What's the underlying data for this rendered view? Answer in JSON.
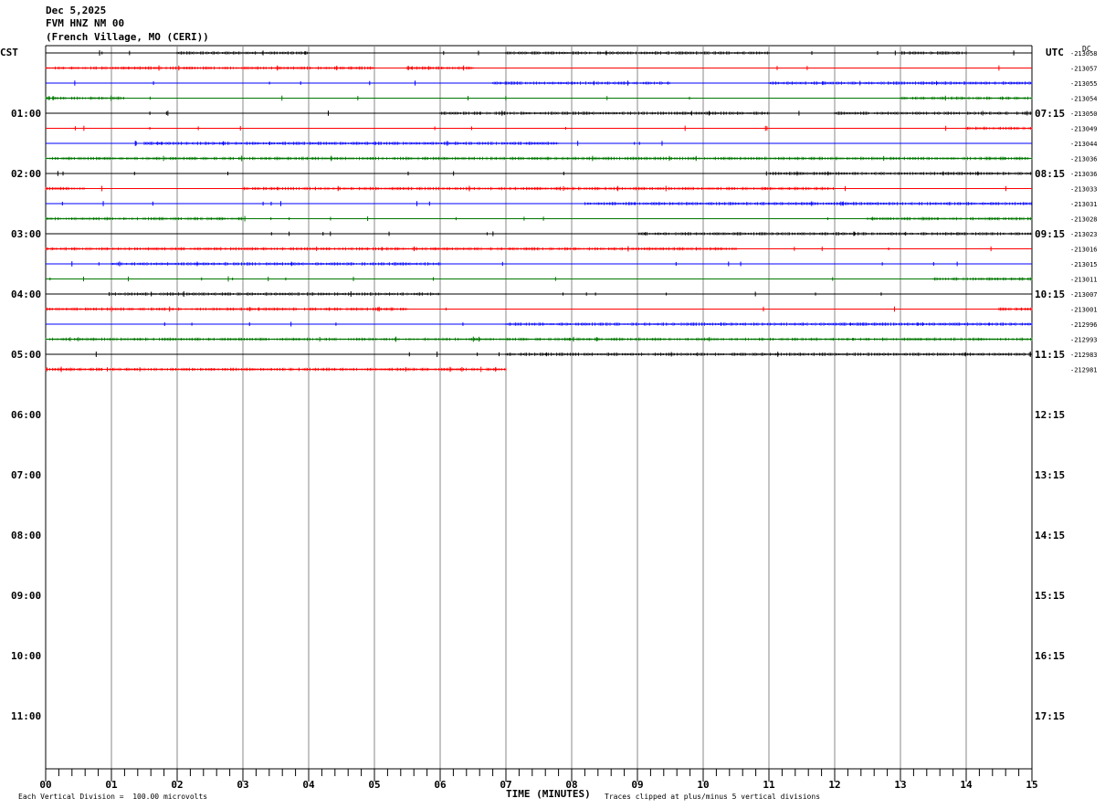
{
  "header": {
    "date": "Dec 5,2025",
    "station": "FVM HNZ NM 00",
    "location": "(French Village, MO (CERI))"
  },
  "left_tz": "CST",
  "right_tz": "UTC",
  "dc_label": "DC",
  "x_axis_title": "TIME (MINUTES)",
  "footer": {
    "scale_note": "Each Vertical Division =  100.00 microvolts",
    "clip_note": "Traces clipped at plus/minus 5 vertical divisions"
  },
  "chart_data": {
    "type": "line",
    "title": "FVM HNZ NM 00",
    "xlabel": "TIME (MINUTES)",
    "xlim": [
      0,
      15
    ],
    "x_ticks": [
      "00",
      "01",
      "02",
      "03",
      "04",
      "05",
      "06",
      "07",
      "08",
      "09",
      "10",
      "11",
      "12",
      "13",
      "14",
      "15"
    ],
    "x_minor_step": 0.2,
    "grid": true,
    "minutes_per_line": 15,
    "line_count": 48,
    "colors": [
      "#000000",
      "#ff0000",
      "#0000ff",
      "#007700"
    ],
    "left_hour_labels": [
      "01:00",
      "02:00",
      "03:00",
      "04:00",
      "05:00",
      "06:00",
      "07:00",
      "08:00",
      "09:00",
      "10:00",
      "11:00"
    ],
    "right_hour_labels": [
      "07:15",
      "08:15",
      "09:15",
      "10:15",
      "11:15",
      "12:15",
      "13:15",
      "14:15",
      "15:15",
      "16:15",
      "17:15"
    ],
    "dc_offsets": [
      "-213058",
      "-213057",
      "-213055",
      "-213054",
      "-213050",
      "-213049",
      "-213044",
      "-213036",
      "-213036",
      "-213033",
      "-213031",
      "-213028",
      "-213023",
      "-213016",
      "-213015",
      "-213011",
      "-213007",
      "-213001",
      "-212996",
      "-212993",
      "-212983",
      "-212981"
    ],
    "traces": [
      {
        "line": 0,
        "start": 0,
        "end": 15,
        "quiet": [
          [
            0,
            4
          ],
          [
            5,
            10.5
          ],
          [
            12,
            14
          ]
        ],
        "noisy": [
          [
            2,
            4
          ],
          [
            7,
            11
          ],
          [
            13,
            14
          ]
        ]
      },
      {
        "line": 1,
        "start": 0,
        "end": 15,
        "noisy": [
          [
            0,
            5
          ],
          [
            5.5,
            6.5
          ]
        ]
      },
      {
        "line": 2,
        "start": 0,
        "end": 15,
        "noisy": [
          [
            6.8,
            9.5
          ],
          [
            11,
            15
          ]
        ]
      },
      {
        "line": 3,
        "start": 0,
        "end": 15,
        "noisy": [
          [
            0,
            1.2
          ],
          [
            13,
            15
          ]
        ]
      },
      {
        "line": 4,
        "start": 0,
        "end": 15,
        "noisy": [
          [
            6,
            11
          ],
          [
            12,
            15
          ]
        ]
      },
      {
        "line": 5,
        "start": 0,
        "end": 15,
        "noisy": [
          [
            14,
            15
          ]
        ]
      },
      {
        "line": 6,
        "start": 0,
        "end": 15,
        "noisy": [
          [
            1.5,
            7.8
          ]
        ]
      },
      {
        "line": 7,
        "start": 0,
        "end": 15,
        "noisy": [
          [
            0,
            15
          ]
        ]
      },
      {
        "line": 8,
        "start": 0,
        "end": 15,
        "noisy": [
          [
            11,
            15
          ]
        ]
      },
      {
        "line": 9,
        "start": 0,
        "end": 15,
        "noisy": [
          [
            0,
            0.6
          ],
          [
            3,
            12
          ]
        ]
      },
      {
        "line": 10,
        "start": 0,
        "end": 15,
        "noisy": [
          [
            8.2,
            15
          ]
        ]
      },
      {
        "line": 11,
        "start": 0,
        "end": 15,
        "noisy": [
          [
            0,
            3
          ],
          [
            12.5,
            15
          ]
        ]
      },
      {
        "line": 12,
        "start": 0,
        "end": 15,
        "noisy": [
          [
            9,
            15
          ]
        ]
      },
      {
        "line": 13,
        "start": 0,
        "end": 15,
        "noisy": [
          [
            0,
            10.5
          ]
        ]
      },
      {
        "line": 14,
        "start": 0,
        "end": 15,
        "noisy": [
          [
            1,
            6
          ]
        ]
      },
      {
        "line": 15,
        "start": 0,
        "end": 15,
        "noisy": [
          [
            13.5,
            15
          ]
        ]
      },
      {
        "line": 16,
        "start": 0,
        "end": 15,
        "noisy": [
          [
            1,
            6
          ]
        ]
      },
      {
        "line": 17,
        "start": 0,
        "end": 15,
        "noisy": [
          [
            0,
            5.5
          ],
          [
            14.5,
            15
          ]
        ]
      },
      {
        "line": 18,
        "start": 0,
        "end": 15,
        "noisy": [
          [
            7,
            15
          ]
        ]
      },
      {
        "line": 19,
        "start": 0,
        "end": 15,
        "noisy": [
          [
            0,
            15
          ]
        ]
      },
      {
        "line": 20,
        "start": 0,
        "end": 15,
        "noisy": [
          [
            7,
            15
          ]
        ]
      },
      {
        "line": 21,
        "start": 0,
        "end": 7,
        "noisy": [
          [
            0,
            7
          ]
        ]
      }
    ]
  }
}
